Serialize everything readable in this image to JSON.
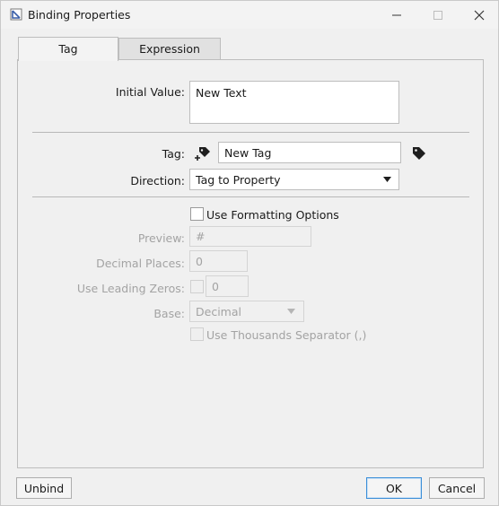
{
  "window": {
    "title": "Binding Properties",
    "icons": [
      "app-icon",
      "minimize-icon",
      "maximize-icon",
      "close-icon"
    ]
  },
  "tabs": [
    {
      "label": "Tag",
      "active": true
    },
    {
      "label": "Expression",
      "active": false
    }
  ],
  "form": {
    "initial_value_label": "Initial Value:",
    "initial_value": "New Text",
    "tag_label": "Tag:",
    "tag_value": "New Tag",
    "tag_icons": [
      "tag-add-icon",
      "tag-browse-icon"
    ],
    "direction_label": "Direction:",
    "direction_value": "Tag to Property"
  },
  "formatting": {
    "use_formatting_label": "Use Formatting Options",
    "use_formatting_checked": false,
    "preview_label": "Preview:",
    "preview_value": "#",
    "decimal_places_label": "Decimal Places:",
    "decimal_places_value": "0",
    "leading_zeros_label": "Use Leading Zeros:",
    "leading_zeros_value": "0",
    "base_label": "Base:",
    "base_value": "Decimal",
    "thousands_label": "Use Thousands Separator (,)"
  },
  "buttons": {
    "unbind": "Unbind",
    "ok": "OK",
    "cancel": "Cancel"
  },
  "colors": {
    "accent": "#3b8ed8",
    "disabled_text": "#a3a3a3"
  }
}
